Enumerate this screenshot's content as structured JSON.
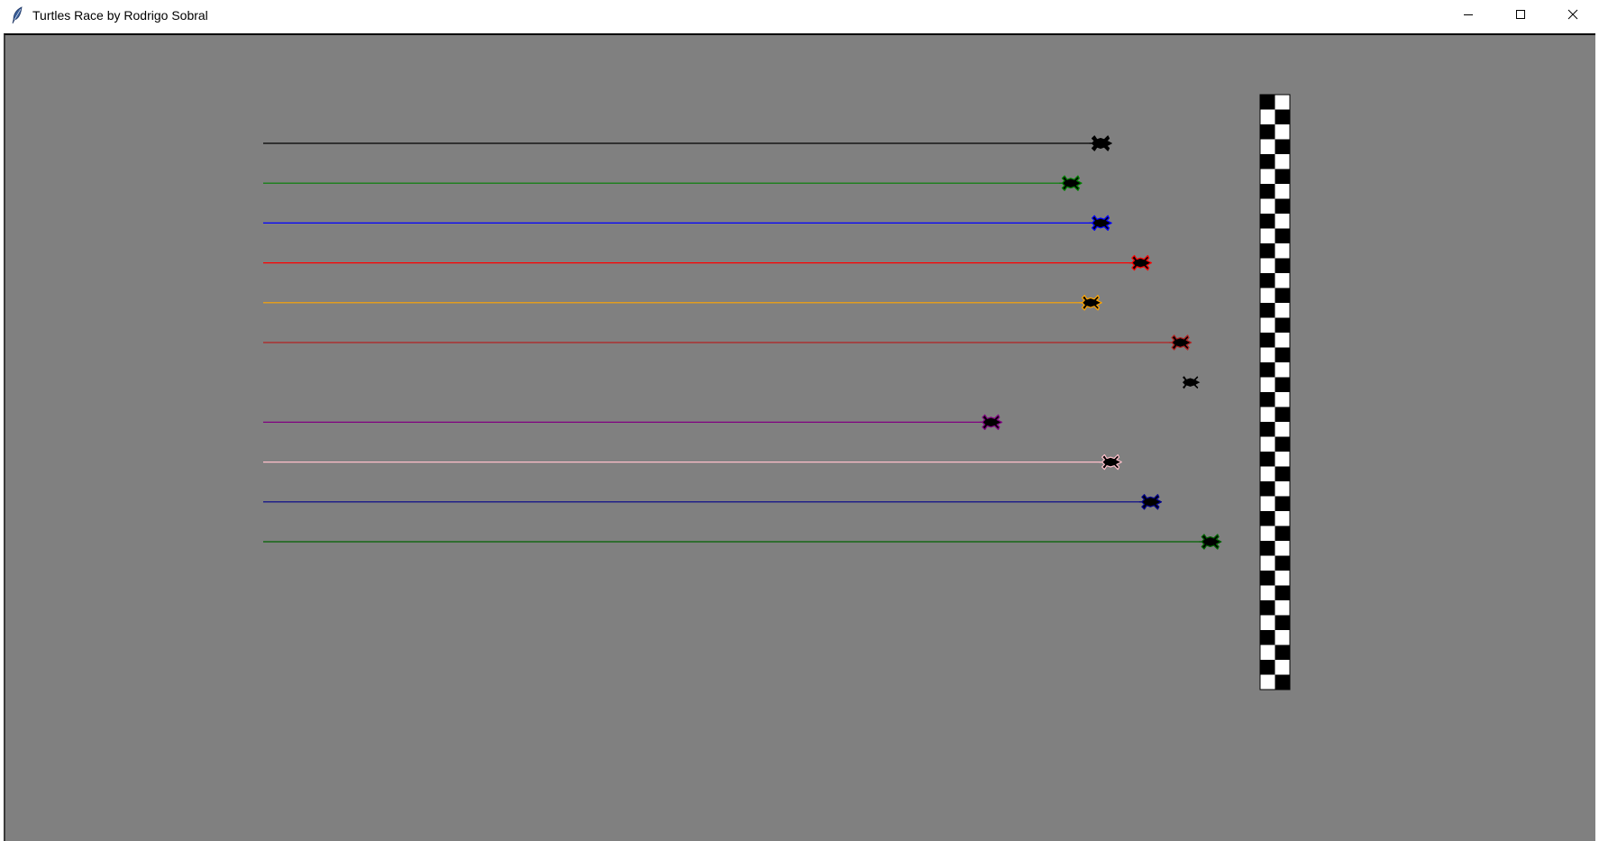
{
  "window": {
    "title": "Turtles Race by Rodrigo Sobral",
    "controls": {
      "minimize": "minimize-icon",
      "maximize": "maximize-icon",
      "close": "close-icon"
    }
  },
  "canvas": {
    "background": "#808080"
  },
  "finish_line": {
    "pattern": "checkered",
    "colors": [
      "#000000",
      "#ffffff"
    ]
  },
  "race": {
    "lanes": [
      {
        "color": "#000000",
        "progress": 0.84,
        "trail": true
      },
      {
        "color": "#008000",
        "progress": 0.81,
        "trail": true
      },
      {
        "color": "#0000ff",
        "progress": 0.84,
        "trail": true
      },
      {
        "color": "#ff0000",
        "progress": 0.88,
        "trail": true
      },
      {
        "color": "#ffa500",
        "progress": 0.83,
        "trail": true
      },
      {
        "color": "#b22222",
        "progress": 0.92,
        "trail": true
      },
      {
        "color": "#808080",
        "progress": 0.93,
        "trail": false
      },
      {
        "color": "#800080",
        "progress": 0.73,
        "trail": true
      },
      {
        "color": "#ffc0cb",
        "progress": 0.85,
        "trail": true
      },
      {
        "color": "#00008b",
        "progress": 0.89,
        "trail": true
      },
      {
        "color": "#006400",
        "progress": 0.95,
        "trail": true
      }
    ]
  }
}
